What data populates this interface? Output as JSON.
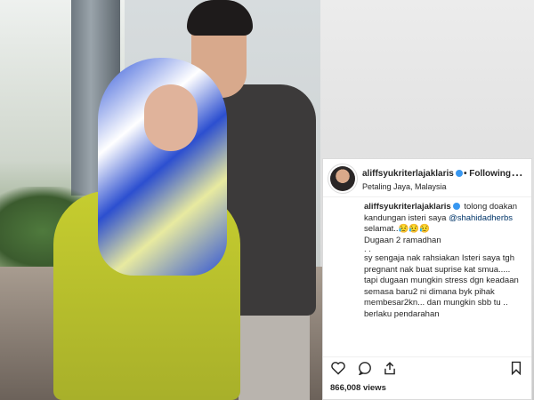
{
  "post": {
    "username": "aliffsyukriterlajaklaris",
    "follow_label": "• Following",
    "location": "Petaling Jaya, Malaysia",
    "more_label": "...",
    "caption": {
      "user": "aliffsyukriterlajaklaris",
      "line1": "tolong doakan kandungan isteri saya",
      "mention": "@shahidadherbs",
      "line2": "selamat..😥😥😥",
      "line3": "Dugaan 2 ramadhan",
      "dots": ". .",
      "body": "sy sengaja nak rahsiakan Isteri saya tgh pregnant nak buat suprise kat smua..... tapi dugaan mungkin stress dgn keadaan semasa baru2 ni dimana byk pihak membesar2kn... dan mungkin sbb tu .. berlaku pendarahan"
    },
    "views": "866,008 views"
  },
  "icons": [
    "heart-icon",
    "comment-icon",
    "share-icon",
    "bookmark-icon",
    "verified-badge-icon"
  ],
  "colors": {
    "verified": "#3897f0",
    "text": "#262626",
    "mention": "#003569",
    "border": "#dbdbdb"
  }
}
